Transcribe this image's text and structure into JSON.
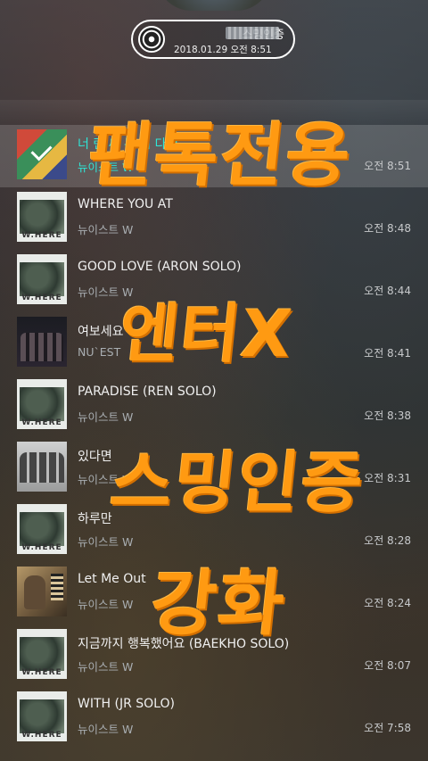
{
  "certification": {
    "title": "스밍인증",
    "datetime": "2018.01.29 오전 8:51"
  },
  "songs": [
    {
      "title": "너 란 씨 무 니 다 2",
      "artist": "뉴이스트 W",
      "time": "오전 8:51",
      "selected": true
    },
    {
      "title": "WHERE YOU AT",
      "artist": "뉴이스트 W",
      "time": "오전 8:48"
    },
    {
      "title": "GOOD LOVE (ARON SOLO)",
      "artist": "뉴이스트 W",
      "time": "오전 8:44"
    },
    {
      "title": "여보세요",
      "artist": "NU`EST",
      "time": "오전 8:41"
    },
    {
      "title": "PARADISE (REN SOLO)",
      "artist": "뉴이스트 W",
      "time": "오전 8:38"
    },
    {
      "title": "있다면",
      "artist": "뉴이스트 W",
      "time": "오전 8:31"
    },
    {
      "title": "하루만",
      "artist": "뉴이스트 W",
      "time": "오전 8:28"
    },
    {
      "title": "Let Me Out",
      "artist": "뉴이스트 W",
      "time": "오전 8:24"
    },
    {
      "title": "지금까지 행복했어요 (BAEKHO SOLO)",
      "artist": "뉴이스트 W",
      "time": "오전 8:07"
    },
    {
      "title": "WITH (JR SOLO)",
      "artist": "뉴이스트 W",
      "time": "오전 7:58"
    }
  ],
  "album_art_label": "W.HERE",
  "overlay": {
    "line1": "팬톡전용",
    "line2": "엔터X",
    "line3": "스밍인증",
    "line4": "강화",
    "color": "#ff9a12"
  },
  "colors": {
    "selected_text": "#2ee6d7"
  }
}
